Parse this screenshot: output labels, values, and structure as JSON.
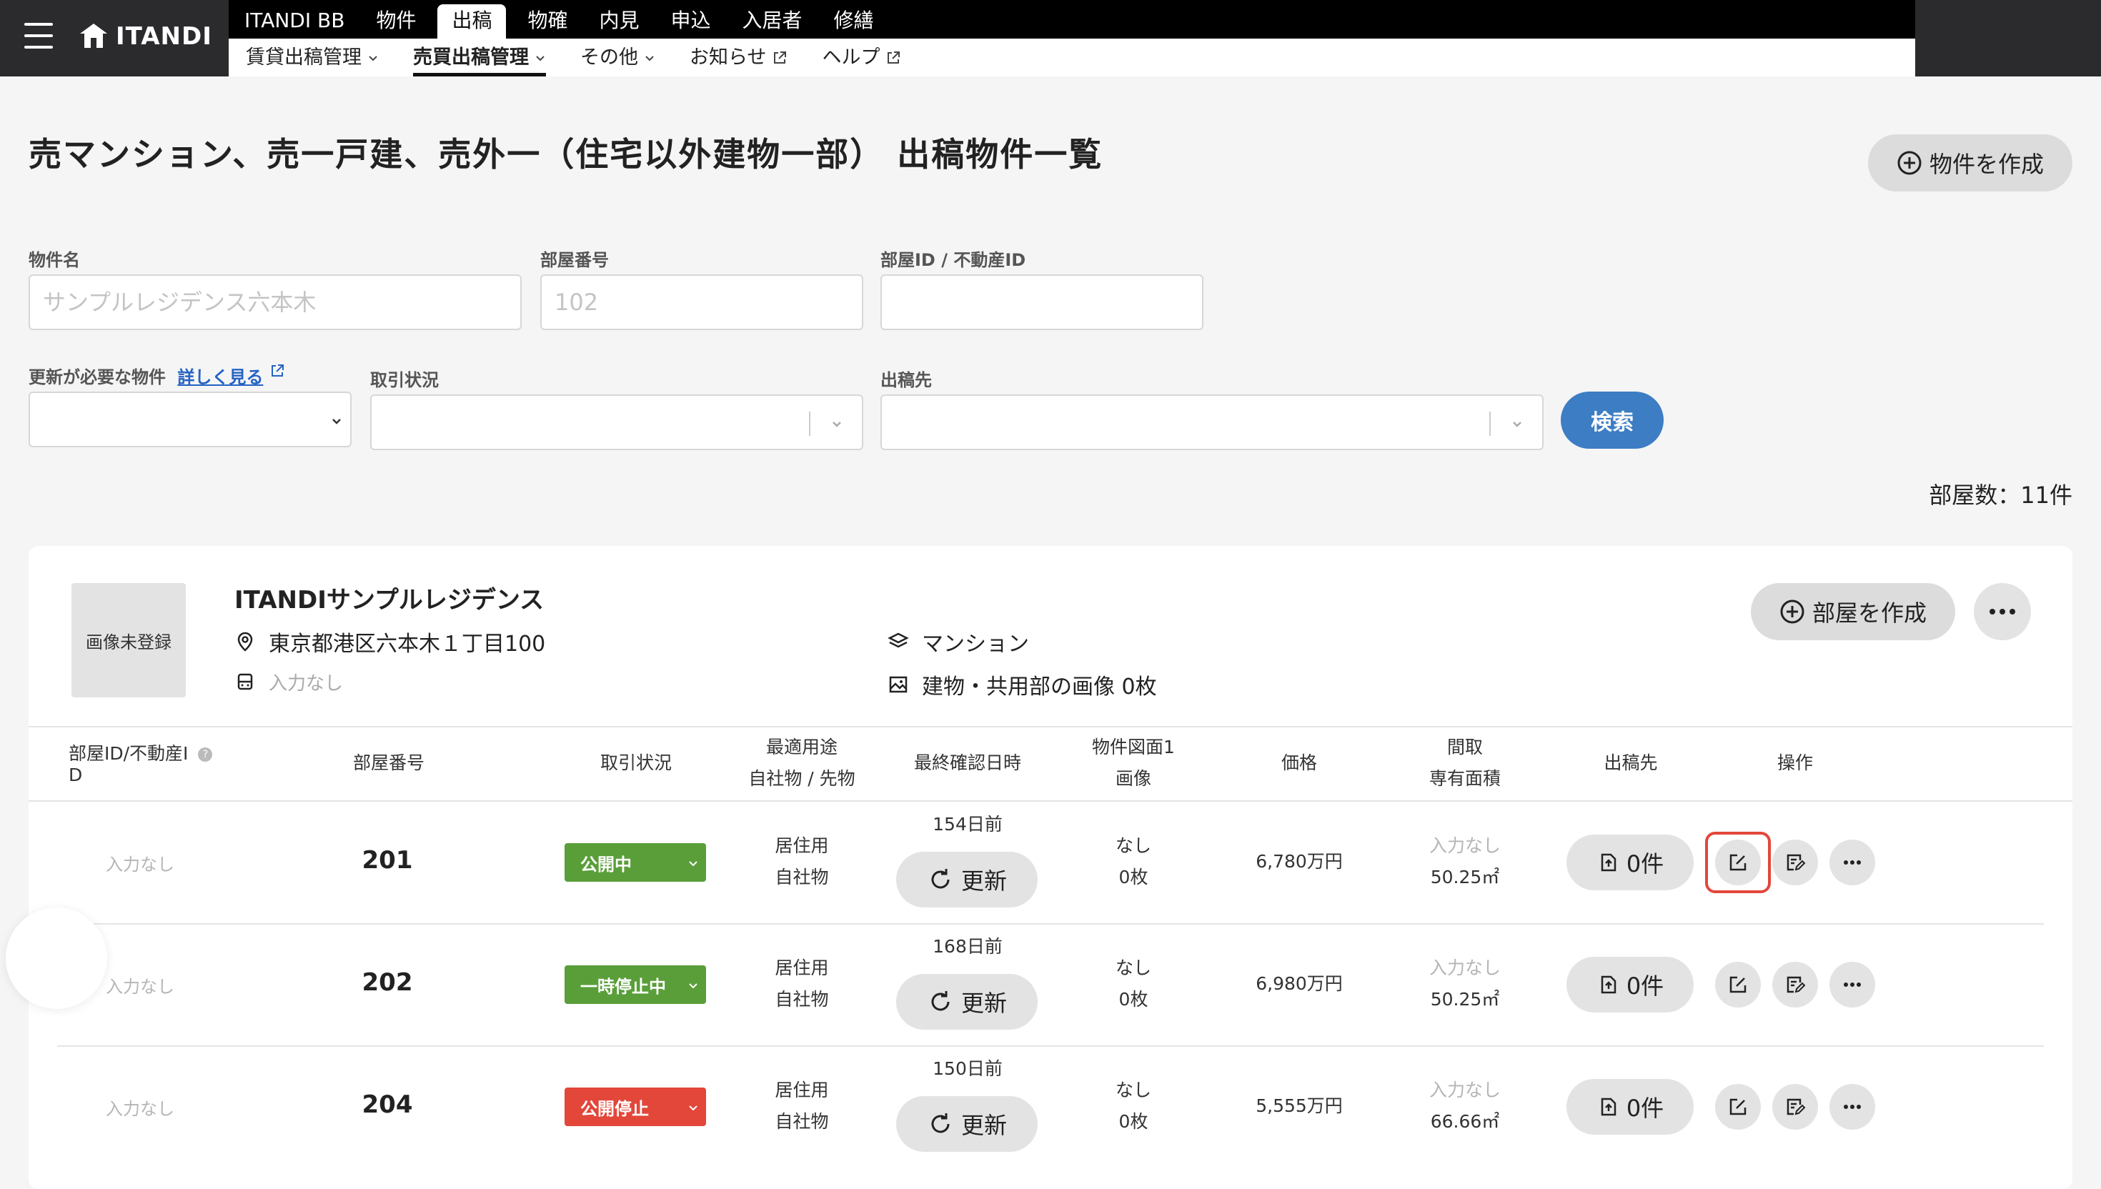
{
  "app": {
    "logo_text": "ITANDI",
    "brand_color": "#2b2b2e",
    "accent_blue": "#3d7dc4"
  },
  "main_nav": {
    "tabs": [
      {
        "label": "ITANDI BB"
      },
      {
        "label": "物件"
      },
      {
        "label": "出稿",
        "active": true
      },
      {
        "label": "物確"
      },
      {
        "label": "内見"
      },
      {
        "label": "申込"
      },
      {
        "label": "入居者"
      },
      {
        "label": "修繕"
      }
    ]
  },
  "sub_nav": {
    "tabs": [
      {
        "label": "賃貸出稿管理",
        "icon": "chevron-down-icon"
      },
      {
        "label": "売買出稿管理",
        "icon": "chevron-down-icon",
        "active": true
      },
      {
        "label": "その他",
        "icon": "chevron-down-icon"
      },
      {
        "label": "お知らせ",
        "icon": "external-link-icon"
      },
      {
        "label": "ヘルプ",
        "icon": "external-link-icon"
      }
    ]
  },
  "page": {
    "title": "売マンション、売一戸建、売外一（住宅以外建物一部） 出稿物件一覧",
    "create_property_label": "物件を作成"
  },
  "search": {
    "property_name_label": "物件名",
    "property_name_placeholder": "サンプルレジデンス六本木",
    "room_number_label": "部屋番号",
    "room_number_placeholder": "102",
    "room_id_label": "部屋ID / 不動産ID",
    "room_id_placeholder": "",
    "needs_update_label": "更新が必要な物件",
    "details_link": "詳しく見る",
    "transaction_status_label": "取引状況",
    "destination_label": "出稿先",
    "search_button": "検索"
  },
  "room_count": "部屋数：11件",
  "property": {
    "thumbnail_text": "画像未登録",
    "name": "ITANDIサンプルレジデンス",
    "address": "東京都港区六本木１丁目100",
    "station": "入力なし",
    "type": "マンション",
    "images": "建物・共用部の画像 0枚",
    "create_room_label": "部屋を作成"
  },
  "table": {
    "headers": {
      "room_id_line1": "部屋ID/不動産I",
      "room_id_line2": "D",
      "room_number": "部屋番号",
      "transaction_status": "取引状況",
      "usage_line1": "最適用途",
      "usage_line2": "自社物 / 先物",
      "last_confirmed": "最終確認日時",
      "floorplan_line1": "物件図面1",
      "floorplan_line2": "画像",
      "price": "価格",
      "layout_line1": "間取",
      "layout_line2": "専有面積",
      "destination": "出稿先",
      "actions": "操作"
    },
    "rows": [
      {
        "room_id": "入力なし",
        "room_number": "201",
        "status": "公開中",
        "status_color": "#5a9e3a",
        "usage": "居住用",
        "ownership": "自社物",
        "days_ago": "154日前",
        "update_label": "更新",
        "floorplan": "なし",
        "image_count": "0枚",
        "price": "6,780万円",
        "layout": "入力なし",
        "area": "50.25㎡",
        "destination_count": "0件"
      },
      {
        "room_id": "入力なし",
        "room_number": "202",
        "status": "一時停止中",
        "status_color": "#5a9e3a",
        "usage": "居住用",
        "ownership": "自社物",
        "days_ago": "168日前",
        "update_label": "更新",
        "floorplan": "なし",
        "image_count": "0枚",
        "price": "6,980万円",
        "layout": "入力なし",
        "area": "50.25㎡",
        "destination_count": "0件"
      },
      {
        "room_id": "入力なし",
        "room_number": "204",
        "status": "公開停止",
        "status_color": "#e2473a",
        "usage": "居住用",
        "ownership": "自社物",
        "days_ago": "150日前",
        "update_label": "更新",
        "floorplan": "なし",
        "image_count": "0枚",
        "price": "5,555万円",
        "layout": "入力なし",
        "area": "66.66㎡",
        "destination_count": "0件"
      }
    ]
  }
}
